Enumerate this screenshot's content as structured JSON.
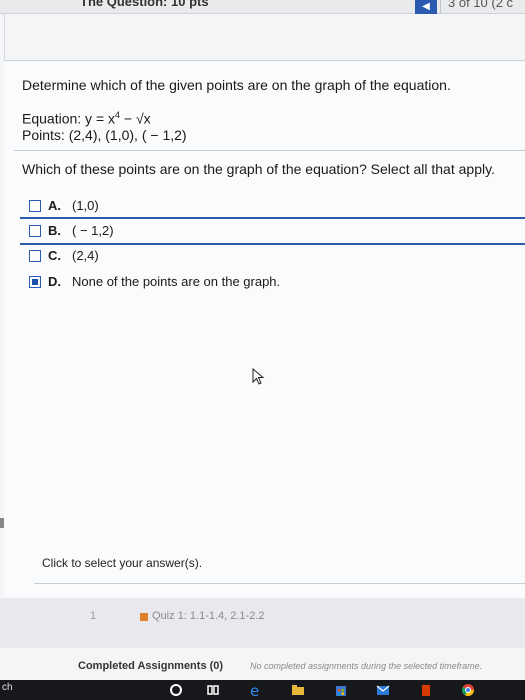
{
  "header": {
    "title": "The Question: 10 pts",
    "counter": "3 of 10 (2 c"
  },
  "question": {
    "instruction": "Determine which of the given points are on the graph of the equation.",
    "equation_label": "Equation: y = x",
    "equation_exp": "4",
    "equation_tail": " − √x",
    "points": "Points: (2,4), (1,0), ( − 1,2)",
    "prompt": "Which of these points are on the graph of the equation? Select all that apply."
  },
  "options": [
    {
      "letter": "A.",
      "text": "(1,0)",
      "checked": false
    },
    {
      "letter": "B.",
      "text": "( − 1,2)",
      "checked": false
    },
    {
      "letter": "C.",
      "text": "(2,4)",
      "checked": false
    },
    {
      "letter": "D.",
      "text": "None of the points are on the graph.",
      "checked": true
    }
  ],
  "footer": {
    "note": "Click to select your answer(s)."
  },
  "quiz": {
    "num": "1",
    "label": "Quiz 1: 1.1-1.4, 2.1-2.2"
  },
  "completed": {
    "label": "Completed Assignments (0)",
    "note": "No completed assignments during the selected timeframe."
  },
  "taskbar": {
    "label": "ch"
  },
  "colors": {
    "accent": "#2a5bb0",
    "quiz_marker": "#e07b2a"
  }
}
